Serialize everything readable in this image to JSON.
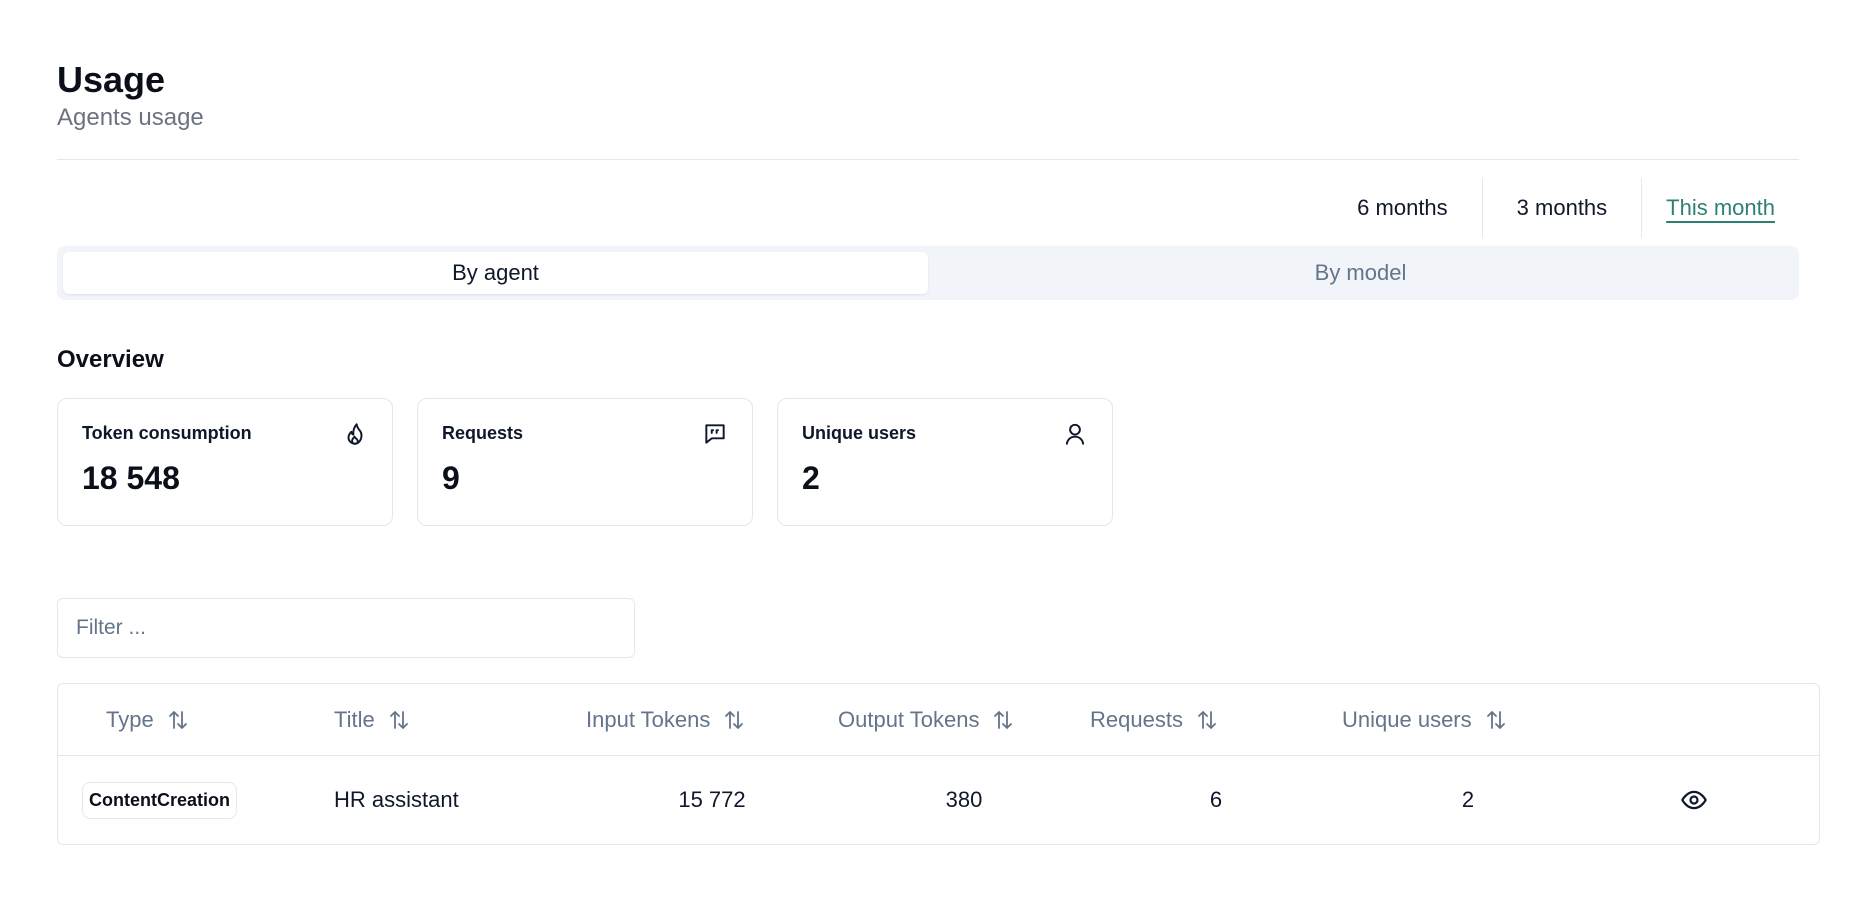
{
  "header": {
    "title": "Usage",
    "subtitle": "Agents usage"
  },
  "range": {
    "options": [
      "6 months",
      "3 months",
      "This month"
    ],
    "active": "This month"
  },
  "view_toggle": {
    "options": [
      "By agent",
      "By model"
    ],
    "active": "By agent"
  },
  "overview": {
    "title": "Overview",
    "cards": [
      {
        "label": "Token consumption",
        "value": "18 548",
        "icon": "flame-icon"
      },
      {
        "label": "Requests",
        "value": "9",
        "icon": "message-quote-icon"
      },
      {
        "label": "Unique users",
        "value": "2",
        "icon": "user-icon"
      }
    ]
  },
  "filter": {
    "placeholder": "Filter ...",
    "value": ""
  },
  "table": {
    "columns": [
      "Type",
      "Title",
      "Input Tokens",
      "Output Tokens",
      "Requests",
      "Unique users"
    ],
    "rows": [
      {
        "type": "ContentCreation",
        "title": "HR assistant",
        "input_tokens": "15 772",
        "output_tokens": "380",
        "requests": "6",
        "unique_users": "2",
        "action_icon": "eye-icon"
      }
    ]
  },
  "colors": {
    "accent": "#2f7f74",
    "muted_text": "#64748b",
    "border": "#e5e7eb",
    "segment_bg": "#f1f5f9"
  }
}
